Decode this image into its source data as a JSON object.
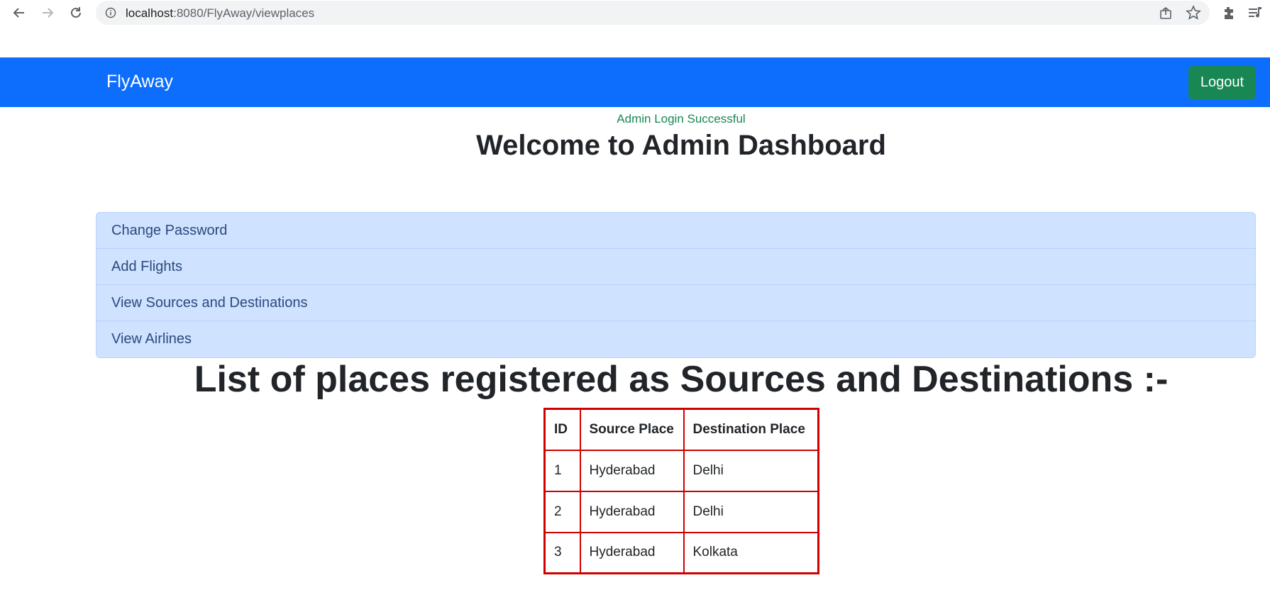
{
  "browser": {
    "url_host": "localhost",
    "url_path": ":8080/FlyAway/viewplaces"
  },
  "navbar": {
    "brand": "FlyAway",
    "logout_label": "Logout",
    "color": "#0d6efd",
    "logout_color": "#198754"
  },
  "main": {
    "success_message": "Admin Login Successful",
    "title": "Welcome to Admin Dashboard",
    "menu": [
      {
        "label": "Change Password"
      },
      {
        "label": "Add Flights"
      },
      {
        "label": "View Sources and Destinations"
      },
      {
        "label": "View Airlines"
      }
    ],
    "list_title": "List of places registered as Sources and Destinations :-"
  },
  "table": {
    "headers": [
      "ID",
      "Source Place",
      "Destination Place"
    ],
    "rows": [
      [
        "1",
        "Hyderabad",
        "Delhi"
      ],
      [
        "2",
        "Hyderabad",
        "Delhi"
      ],
      [
        "3",
        "Hyderabad",
        "Kolkata"
      ]
    ],
    "border_color": "#d00000"
  }
}
